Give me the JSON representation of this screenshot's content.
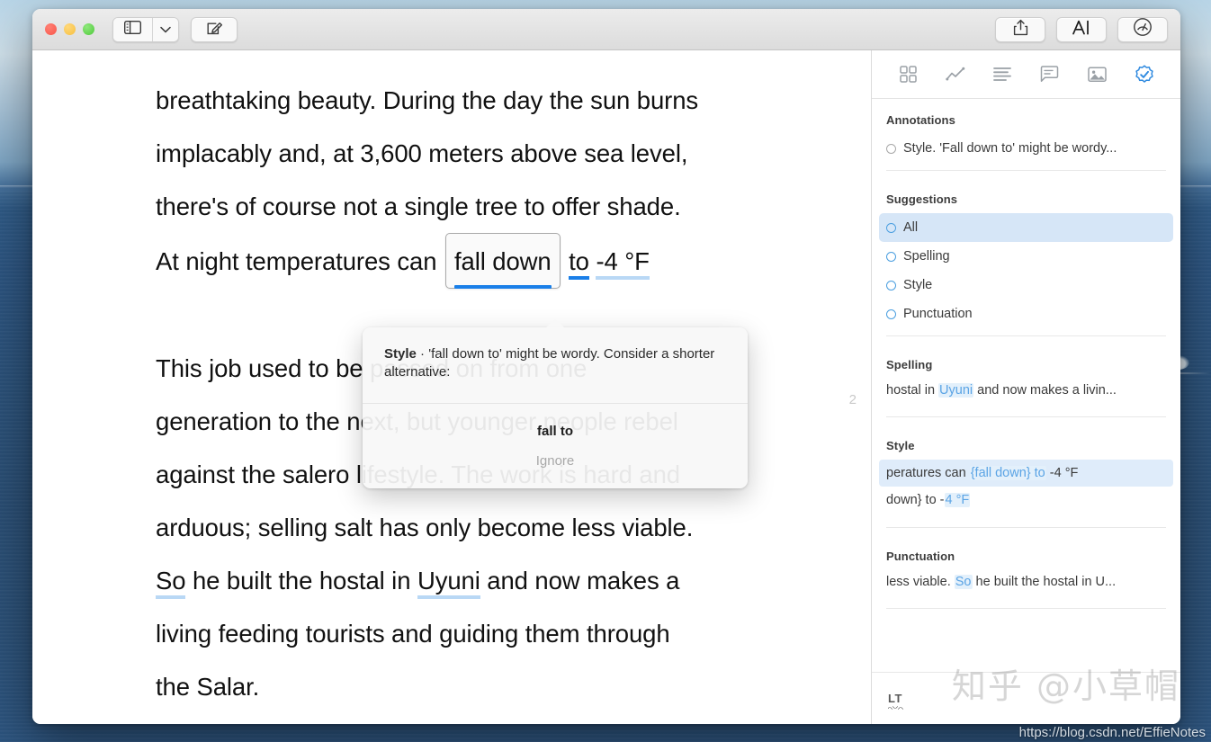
{
  "window": {
    "traffic_lights": [
      "close",
      "minimize",
      "zoom"
    ],
    "toolbar_left": [
      {
        "name": "sidebar-toggle",
        "icon": "sidebar-icon"
      },
      {
        "name": "sidebar-dropdown",
        "icon": "chevron-down-icon"
      },
      {
        "name": "compose",
        "icon": "compose-icon"
      }
    ],
    "toolbar_right": [
      {
        "name": "share",
        "icon": "share-icon"
      },
      {
        "name": "format",
        "icon": "text-format-icon",
        "label": "A"
      },
      {
        "name": "performance",
        "icon": "gauge-icon"
      }
    ]
  },
  "document": {
    "page_number": "2",
    "paragraphs": [
      {
        "id": "p1",
        "lines": [
          "breathtaking beauty. During the day the sun burns",
          "implacably and, at 3,600 meters above sea level,",
          "there's of course not a single tree to offer shade."
        ],
        "last_line": {
          "before": "At night temperatures can",
          "chip": "fall down",
          "after_underlined": "to",
          "tail_underlined": "-4 °F"
        }
      },
      {
        "id": "p2",
        "lines": [
          "This job used to be passed on from one",
          "generation to the next, but younger people rebel",
          "against the salero lifestyle. The work is hard and",
          "arduous; selling salt has only become less viable."
        ],
        "line5": {
          "underline_word_1": "So",
          "mid": " he built the hostal in ",
          "underline_word_2": "Uyuni",
          "tail": " and now makes a"
        },
        "lines_tail": [
          "living feeding tourists and guiding them through",
          "the Salar."
        ]
      }
    ]
  },
  "popup": {
    "category": "Style",
    "separator": " · ",
    "message": "'fall down to' might be wordy. Consider a shorter alternative:",
    "suggestion": "fall to",
    "ignore_label": "Ignore"
  },
  "sidebar": {
    "toolbar_icons": [
      {
        "name": "grid-icon",
        "active": false
      },
      {
        "name": "chart-line-icon",
        "active": false
      },
      {
        "name": "list-icon",
        "active": false
      },
      {
        "name": "comment-icon",
        "active": false
      },
      {
        "name": "image-icon",
        "active": false
      },
      {
        "name": "check-badge-icon",
        "active": true
      }
    ],
    "annotations": {
      "title": "Annotations",
      "items": [
        {
          "text": "Style. 'Fall down to' might be wordy..."
        }
      ]
    },
    "suggestions": {
      "title": "Suggestions",
      "options": [
        {
          "label": "All",
          "selected": true
        },
        {
          "label": "Spelling",
          "selected": false
        },
        {
          "label": "Style",
          "selected": false
        },
        {
          "label": "Punctuation",
          "selected": false
        }
      ]
    },
    "spelling": {
      "title": "Spelling",
      "prefix": "hostal in ",
      "highlight": "Uyuni",
      "suffix": " and now makes a livin..."
    },
    "style": {
      "title": "Style",
      "row1": {
        "prefix": "peratures can ",
        "highlight": "{fall down} to",
        "suffix": " -4 °F"
      },
      "row2": {
        "prefix": "down} to -",
        "highlight": "4 °F"
      }
    },
    "punctuation": {
      "title": "Punctuation",
      "prefix": "less viable. ",
      "highlight": "So",
      "suffix": " he built the hostal in U..."
    },
    "footer": {
      "logo": "LT"
    }
  },
  "watermarks": {
    "zhihu": "知乎 @小草帽",
    "csdn": "https://blog.csdn.net/EffieNotes"
  },
  "colors": {
    "accent_blue": "#1a7fe8",
    "light_blue_underline": "#b9d8f5",
    "selection_bg": "#d6e6f7",
    "sidebar_active_icon": "#2f8ae0"
  }
}
